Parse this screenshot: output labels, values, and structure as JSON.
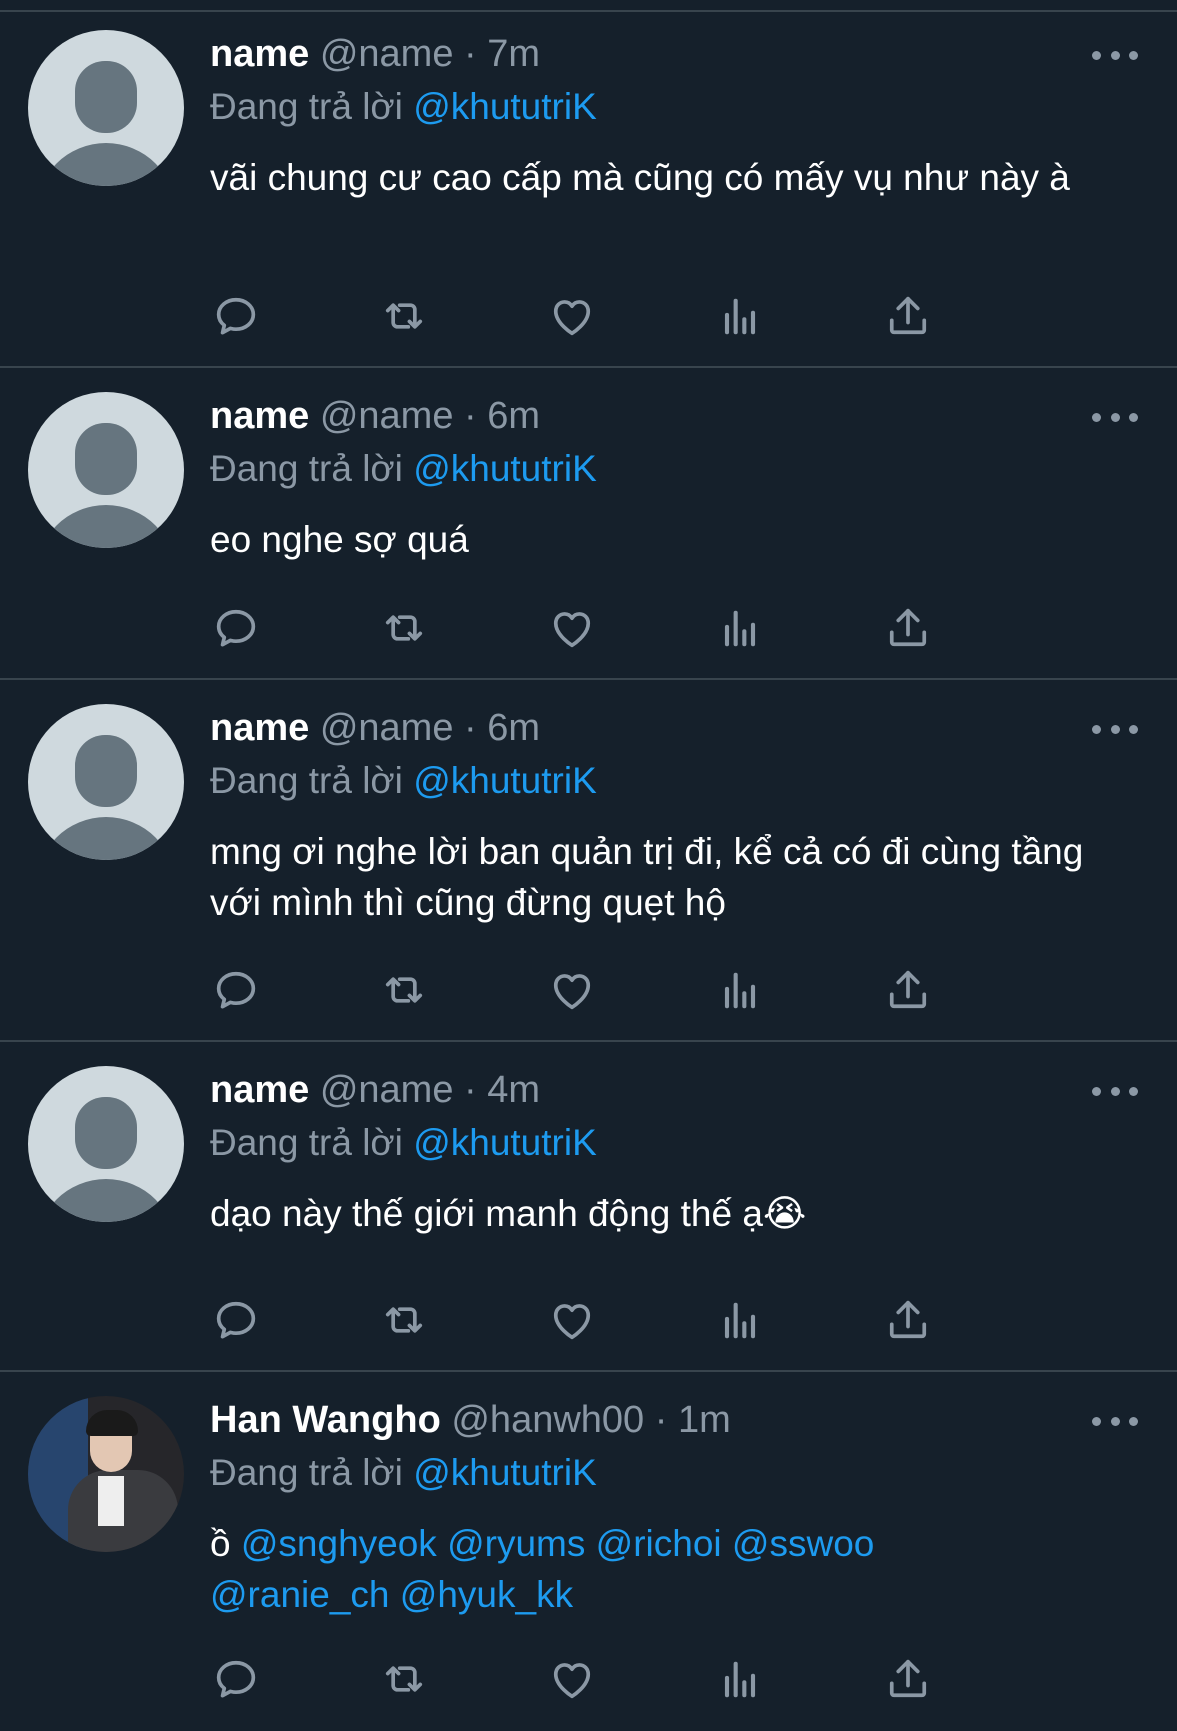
{
  "tweets": [
    {
      "name": "name",
      "handle": "@name",
      "separator": "·",
      "time": "7m",
      "reply_prefix": "Đang trả lời",
      "reply_to": "@khututriK",
      "text": "vãi chung cư cao cấp mà cũng có mấy vụ như này à",
      "avatar": "default-avatar"
    },
    {
      "name": "name",
      "handle": "@name",
      "separator": "·",
      "time": "6m",
      "reply_prefix": "Đang trả lời",
      "reply_to": "@khututriK",
      "text": "eo nghe sợ quá",
      "avatar": "default-avatar"
    },
    {
      "name": "name",
      "handle": "@name",
      "separator": "·",
      "time": "6m",
      "reply_prefix": "Đang trả lời",
      "reply_to": "@khututriK",
      "text": "mng ơi nghe lời ban quản trị đi, kể cả có đi cùng tầng với mình thì cũng đừng quẹt hộ",
      "avatar": "default-avatar"
    },
    {
      "name": "name",
      "handle": "@name",
      "separator": "·",
      "time": "4m",
      "reply_prefix": "Đang trả lời",
      "reply_to": "@khututriK",
      "text": "dạo này thế giới manh động thế ạ",
      "emoji": "😭",
      "avatar": "default-avatar"
    },
    {
      "name": "Han Wangho",
      "handle": "@hanwh00",
      "separator": "·",
      "time": "1m",
      "reply_prefix": "Đang trả lời",
      "reply_to": "@khututriK",
      "text_prefix": "ồ",
      "mentions": [
        "@snghyeok",
        "@ryums",
        "@richoi",
        "@sswoo",
        "@ranie_ch",
        "@hyuk_kk"
      ],
      "avatar": "photo-avatar"
    }
  ],
  "icons": {
    "reply": "reply-icon",
    "retweet": "retweet-icon",
    "like": "heart-icon",
    "views": "views-icon",
    "share": "share-icon",
    "more": "more-icon"
  },
  "colors": {
    "background": "#15202b",
    "divider": "#38444d",
    "secondary_text": "#8b98a5",
    "mention": "#1d9bf0",
    "icon": "#8b98a5"
  }
}
